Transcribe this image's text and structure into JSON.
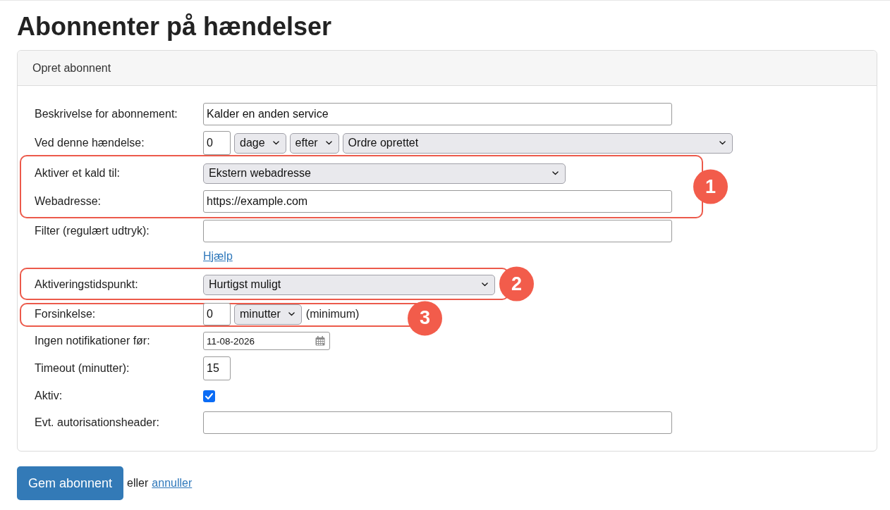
{
  "title": "Abonnenter på hændelser",
  "card": {
    "header": "Opret abonnent",
    "sections": [
      {
        "kind": "plain",
        "rows": [
          {
            "label": "Beskrivelse for abonnement:",
            "controls": [
              {
                "kind": "text_input",
                "value": "Kalder en anden service"
              }
            ]
          },
          {
            "label": "Ved denne hændelse:",
            "controls": [
              {
                "kind": "number_input",
                "value": "0"
              },
              {
                "kind": "dropdown",
                "value": "dage"
              },
              {
                "kind": "dropdown",
                "value": "efter"
              },
              {
                "kind": "dropdown",
                "value": "Ordre oprettet"
              }
            ]
          }
        ]
      },
      {
        "kind": "callout",
        "badge": "1",
        "rows": [
          {
            "label": "Aktiver et kald til:",
            "controls": [
              {
                "kind": "dropdown",
                "value": "Ekstern webadresse"
              }
            ]
          },
          {
            "label": "Webadresse:",
            "controls": [
              {
                "kind": "text_input",
                "value": "https://example.com"
              }
            ]
          }
        ]
      },
      {
        "kind": "plain",
        "rows": [
          {
            "label": "Filter (regulært udtryk):",
            "controls": [
              {
                "kind": "text_input"
              }
            ]
          },
          {
            "controls": [
              {
                "kind": "link",
                "text": "Hjælp"
              }
            ]
          }
        ]
      },
      {
        "kind": "callout",
        "badge": "2",
        "rows": [
          {
            "label": "Aktiveringstidspunkt:",
            "controls": [
              {
                "kind": "dropdown",
                "value": "Hurtigst muligt"
              }
            ]
          }
        ]
      },
      {
        "kind": "callout",
        "badge": "3",
        "rows": [
          {
            "label": "Forsinkelse:",
            "controls": [
              {
                "kind": "number_input",
                "value": "0"
              },
              {
                "kind": "dropdown",
                "value": "minutter"
              },
              {
                "kind": "note",
                "text": "(minimum)"
              }
            ]
          }
        ]
      },
      {
        "kind": "plain",
        "rows": [
          {
            "label": "Ingen notifikationer før:",
            "controls": [
              {
                "kind": "date_input",
                "value": "11-08-2026"
              }
            ]
          },
          {
            "label": "Timeout (minutter):",
            "controls": [
              {
                "kind": "number_input",
                "value": "15"
              }
            ]
          },
          {
            "label": "Aktiv:",
            "controls": [
              {
                "kind": "checkbox",
                "checked": true
              }
            ]
          },
          {
            "label": "Evt. autorisationsheader:",
            "controls": [
              {
                "kind": "text_input"
              }
            ]
          }
        ]
      }
    ]
  },
  "footer": {
    "save_button": "Gem abonnent",
    "connector_text": "eller",
    "cancel_link": "annuller"
  }
}
